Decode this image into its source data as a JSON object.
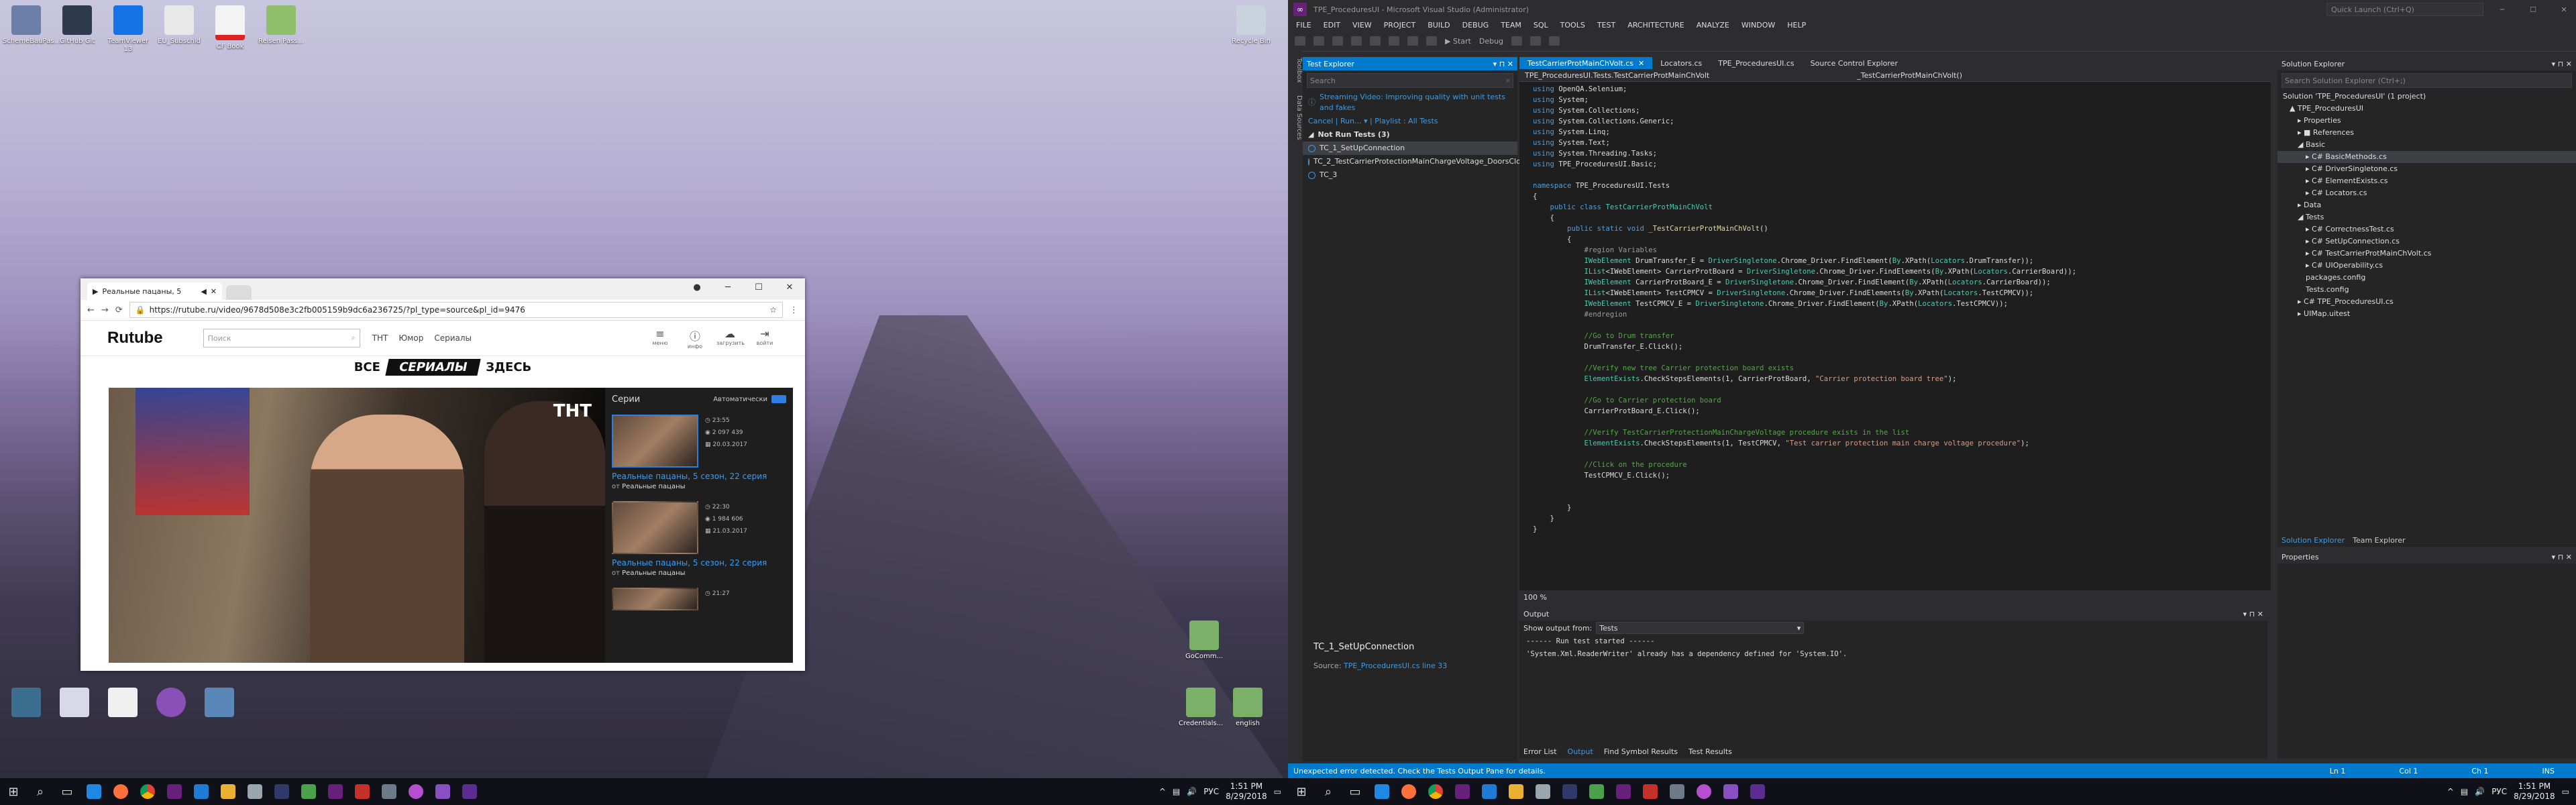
{
  "left_desktop": {
    "top_icons": [
      "SchemeBauPas...",
      "GitHub Git",
      "TeamViewer 13",
      "EU_Subschld",
      "CF Book",
      "Reisen Pass...",
      "Recycle Bin"
    ],
    "bottom_icons": [
      "",
      "",
      "",
      "",
      ""
    ],
    "bottom_right_icons": [
      "GoComm...",
      "Credentials...",
      "english"
    ],
    "recycle_bin": "Recycle Bin",
    "taskbar": {
      "language": "РУС",
      "time": "1:51 PM",
      "date": "8/29/2018"
    }
  },
  "chrome": {
    "tab_title": "Реальные пацаны, 5",
    "url": "https://rutube.ru/video/9678d508e3c2fb005159b9dc6a236725/?pl_type=source&pl_id=9476",
    "rutube": {
      "logo": "Rutube",
      "search_placeholder": "Поиск",
      "nav": [
        "ТНТ",
        "Юмор",
        "Сериалы"
      ],
      "tools": [
        "меню",
        "инфо",
        "загрузить",
        "войти"
      ],
      "banner_left": "ВСЕ",
      "banner_mid": "СЕРИАЛЫ",
      "banner_right": "ЗДЕСЬ",
      "channel": "ТНТ",
      "sidebar_title": "Серии",
      "sidebar_auto": "Автоматически",
      "episodes": [
        {
          "duration": "23:55",
          "views": "2 097 439",
          "date": "20.03.2017",
          "title": "Реальные пацаны, 5 сезон, 22 серия",
          "from_label": "от",
          "from": "Реальные пацаны"
        },
        {
          "duration": "22:30",
          "views": "1 984 606",
          "date": "21.03.2017",
          "title": "Реальные пацаны, 5 сезон, 22 серия",
          "from_label": "от",
          "from": "Реальные пацаны"
        },
        {
          "duration": "21:27",
          "views": "",
          "date": "",
          "title": "",
          "from_label": "",
          "from": ""
        }
      ]
    }
  },
  "vs": {
    "title": "TPE_ProceduresUI - Microsoft Visual Studio (Administrator)",
    "quick_launch": "Quick Launch (Ctrl+Q)",
    "menu": [
      "FILE",
      "EDIT",
      "VIEW",
      "PROJECT",
      "BUILD",
      "DEBUG",
      "TEAM",
      "SQL",
      "TOOLS",
      "TEST",
      "ARCHITECTURE",
      "ANALYZE",
      "WINDOW",
      "HELP"
    ],
    "toolbar": {
      "start": "Start",
      "config": "Debug"
    },
    "rail": [
      "Toolbox",
      "Data Sources"
    ],
    "test_explorer": {
      "title": "Test Explorer",
      "search": "Search",
      "banner": "Streaming Video: Improving quality with unit tests and fakes",
      "run_links": "Cancel  |  Run...  ▾  |  Playlist : All Tests",
      "group": "Not Run Tests (3)",
      "tests": [
        "TC_1_SetUpConnection",
        "TC_2_TestCarrierProtectionMainChargeVoltage_DoorsClosed",
        "TC_3"
      ],
      "detail_title": "TC_1_SetUpConnection",
      "detail_source_label": "Source:",
      "detail_source": "TPE_ProceduresUI.cs line 33"
    },
    "editor": {
      "tabs": [
        "TestCarrierProtMainChVolt.cs",
        "Locators.cs",
        "TPE_ProceduresUI.cs",
        "Source Control Explorer"
      ],
      "nav_left": "TPE_ProceduresUI.Tests.TestCarrierProtMainChVolt",
      "nav_right": "_TestCarrierProtMainChVolt()",
      "zoom": "100 %",
      "lines": [
        [
          [
            "kw",
            "using "
          ],
          [
            "id",
            "OpenQA.Selenium;"
          ]
        ],
        [
          [
            "kw",
            "using "
          ],
          [
            "id",
            "System;"
          ]
        ],
        [
          [
            "kw",
            "using "
          ],
          [
            "id",
            "System.Collections;"
          ]
        ],
        [
          [
            "kw",
            "using "
          ],
          [
            "id",
            "System.Collections.Generic;"
          ]
        ],
        [
          [
            "kw",
            "using "
          ],
          [
            "id",
            "System.Linq;"
          ]
        ],
        [
          [
            "kw",
            "using "
          ],
          [
            "id",
            "System.Text;"
          ]
        ],
        [
          [
            "kw",
            "using "
          ],
          [
            "id",
            "System.Threading.Tasks;"
          ]
        ],
        [
          [
            "kw",
            "using "
          ],
          [
            "id",
            "TPE_ProceduresUI.Basic;"
          ]
        ],
        [
          [
            "id",
            ""
          ]
        ],
        [
          [
            "kw",
            "namespace "
          ],
          [
            "id",
            "TPE_ProceduresUI.Tests"
          ]
        ],
        [
          [
            "id",
            "{"
          ]
        ],
        [
          [
            "id",
            "    "
          ],
          [
            "kw",
            "public class "
          ],
          [
            "ty",
            "TestCarrierProtMainChVolt"
          ]
        ],
        [
          [
            "id",
            "    {"
          ]
        ],
        [
          [
            "id",
            "        "
          ],
          [
            "kw",
            "public static void "
          ],
          [
            "mt",
            "_TestCarrierProtMainChVolt"
          ],
          [
            "id",
            "()"
          ]
        ],
        [
          [
            "id",
            "        {"
          ]
        ],
        [
          [
            "pp",
            "            #region Variables"
          ]
        ],
        [
          [
            "id",
            "            "
          ],
          [
            "ty",
            "IWebElement "
          ],
          [
            "id",
            "DrumTransfer_E = "
          ],
          [
            "ty",
            "DriverSingletone"
          ],
          [
            "id",
            ".Chrome_Driver.FindElement("
          ],
          [
            "ty",
            "By"
          ],
          [
            "id",
            ".XPath("
          ],
          [
            "ty",
            "Locators"
          ],
          [
            "id",
            ".DrumTransfer));"
          ]
        ],
        [
          [
            "id",
            "            "
          ],
          [
            "ty",
            "IList"
          ],
          [
            "id",
            "<IWebElement> CarrierProtBoard = "
          ],
          [
            "ty",
            "DriverSingletone"
          ],
          [
            "id",
            ".Chrome_Driver.FindElements("
          ],
          [
            "ty",
            "By"
          ],
          [
            "id",
            ".XPath("
          ],
          [
            "ty",
            "Locators"
          ],
          [
            "id",
            ".CarrierBoard));"
          ]
        ],
        [
          [
            "id",
            "            "
          ],
          [
            "ty",
            "IWebElement "
          ],
          [
            "id",
            "CarrierProtBoard_E = "
          ],
          [
            "ty",
            "DriverSingletone"
          ],
          [
            "id",
            ".Chrome_Driver.FindElement("
          ],
          [
            "ty",
            "By"
          ],
          [
            "id",
            ".XPath("
          ],
          [
            "ty",
            "Locators"
          ],
          [
            "id",
            ".CarrierBoard));"
          ]
        ],
        [
          [
            "id",
            "            "
          ],
          [
            "ty",
            "IList"
          ],
          [
            "id",
            "<IWebElement> TestCPMCV = "
          ],
          [
            "ty",
            "DriverSingletone"
          ],
          [
            "id",
            ".Chrome_Driver.FindElements("
          ],
          [
            "ty",
            "By"
          ],
          [
            "id",
            ".XPath("
          ],
          [
            "ty",
            "Locators"
          ],
          [
            "id",
            ".TestCPMCV));"
          ]
        ],
        [
          [
            "id",
            "            "
          ],
          [
            "ty",
            "IWebElement "
          ],
          [
            "id",
            "TestCPMCV_E = "
          ],
          [
            "ty",
            "DriverSingletone"
          ],
          [
            "id",
            ".Chrome_Driver.FindElement("
          ],
          [
            "ty",
            "By"
          ],
          [
            "id",
            ".XPath("
          ],
          [
            "ty",
            "Locators"
          ],
          [
            "id",
            ".TestCPMCV));"
          ]
        ],
        [
          [
            "pp",
            "            #endregion"
          ]
        ],
        [
          [
            "id",
            ""
          ]
        ],
        [
          [
            "cm",
            "            //Go to Drum transfer"
          ]
        ],
        [
          [
            "id",
            "            DrumTransfer_E.Click();"
          ]
        ],
        [
          [
            "id",
            ""
          ]
        ],
        [
          [
            "cm",
            "            //Verify new tree Carrier protection board exists"
          ]
        ],
        [
          [
            "id",
            "            "
          ],
          [
            "ty",
            "ElementExists"
          ],
          [
            "id",
            ".CheckStepsElements(1, CarrierProtBoard, "
          ],
          [
            "st",
            "\"Carrier protection board tree\""
          ],
          [
            "id",
            ");"
          ]
        ],
        [
          [
            "id",
            ""
          ]
        ],
        [
          [
            "cm",
            "            //Go to Carrier protection board"
          ]
        ],
        [
          [
            "id",
            "            CarrierProtBoard_E.Click();"
          ]
        ],
        [
          [
            "id",
            ""
          ]
        ],
        [
          [
            "cm",
            "            //Verify TestCarrierProtectionMainChargeVoltage procedure exists in the list"
          ]
        ],
        [
          [
            "id",
            "            "
          ],
          [
            "ty",
            "ElementExists"
          ],
          [
            "id",
            ".CheckStepsElements(1, TestCPMCV, "
          ],
          [
            "st",
            "\"Test carrier protection main charge voltage procedure\""
          ],
          [
            "id",
            ");"
          ]
        ],
        [
          [
            "id",
            ""
          ]
        ],
        [
          [
            "cm",
            "            //Click on the procedure"
          ]
        ],
        [
          [
            "id",
            "            TestCPMCV_E.Click();"
          ]
        ],
        [
          [
            "id",
            ""
          ]
        ],
        [
          [
            "id",
            ""
          ]
        ],
        [
          [
            "id",
            "        }"
          ]
        ],
        [
          [
            "id",
            "    }"
          ]
        ],
        [
          [
            "id",
            "}"
          ]
        ]
      ]
    },
    "output": {
      "title": "Output",
      "show_from_label": "Show output from:",
      "show_from": "Tests",
      "lines": [
        "------ Run test started ------",
        "'System.Xml.ReaderWriter' already has a dependency defined for 'System.IO'."
      ],
      "bottom_tabs": [
        "Error List",
        "Output",
        "Find Symbol Results",
        "Test Results"
      ]
    },
    "solution_explorer": {
      "title": "Solution Explorer",
      "search": "Search Solution Explorer (Ctrl+;)",
      "rows": [
        "Solution 'TPE_ProceduresUI' (1 project)",
        "▲ TPE_ProceduresUI",
        "▸ Properties",
        "▸ ■ References",
        "◢ Basic",
        "▸ C# BasicMethods.cs",
        "▸ C# DriverSingletone.cs",
        "▸ C# ElementExists.cs",
        "▸ C# Locators.cs",
        "▸ Data",
        "◢ Tests",
        "▸ C# CorrectnessTest.cs",
        "▸ C# SetUpConnection.cs",
        "▸ C# TestCarrierProtMainChVolt.cs",
        "▸ C# UIOperability.cs",
        "packages.config",
        "Tests.config",
        "▸ C# TPE_ProceduresUI.cs",
        "▸ UIMap.uitest"
      ],
      "bottom_tabs": [
        "Solution Explorer",
        "Team Explorer"
      ]
    },
    "properties": {
      "title": "Properties"
    },
    "status": {
      "message": "Unexpected error detected. Check the Tests Output Pane for details.",
      "line": "Ln 1",
      "col": "Col 1",
      "ch": "Ch 1",
      "mode": "INS"
    },
    "taskbar": {
      "language": "РУС",
      "time": "1:51 PM",
      "date": "8/29/2018"
    }
  }
}
